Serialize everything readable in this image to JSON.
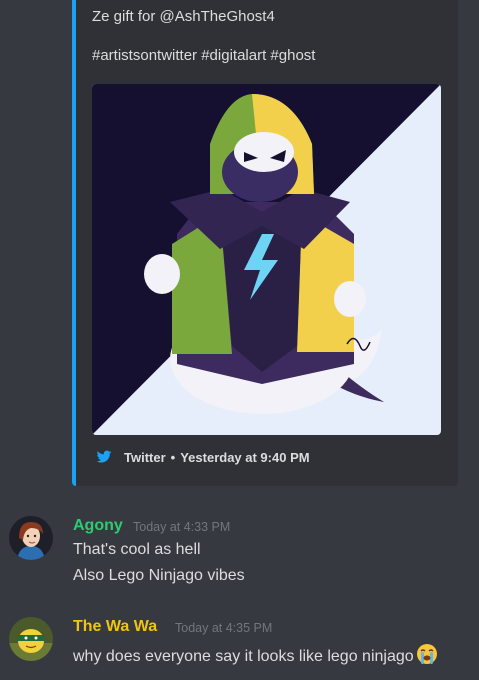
{
  "embed": {
    "description_line1": "Ze gift for @AshTheGhost4",
    "description_line2": "#artistsontwitter #digitalart #ghost",
    "image_icon": "ghost-ninja-artwork",
    "footer": {
      "source": "Twitter",
      "separator": "•",
      "time": "Yesterday at 9:40 PM",
      "icon": "twitter-bird-icon"
    },
    "accent_color": "#1da1f2"
  },
  "messages": [
    {
      "username": "Agony",
      "username_color": "#2ecc71",
      "timestamp": "Today at 4:33 PM",
      "lines": [
        "That's cool as hell",
        "Also Lego Ninjago vibes"
      ]
    },
    {
      "username": "The Wa Wa",
      "username_color": "#f1c40f",
      "timestamp": "Today at 4:35 PM",
      "lines": [
        "why does everyone say it looks like lego ninjago"
      ],
      "emoji": "sob-emoji"
    }
  ]
}
